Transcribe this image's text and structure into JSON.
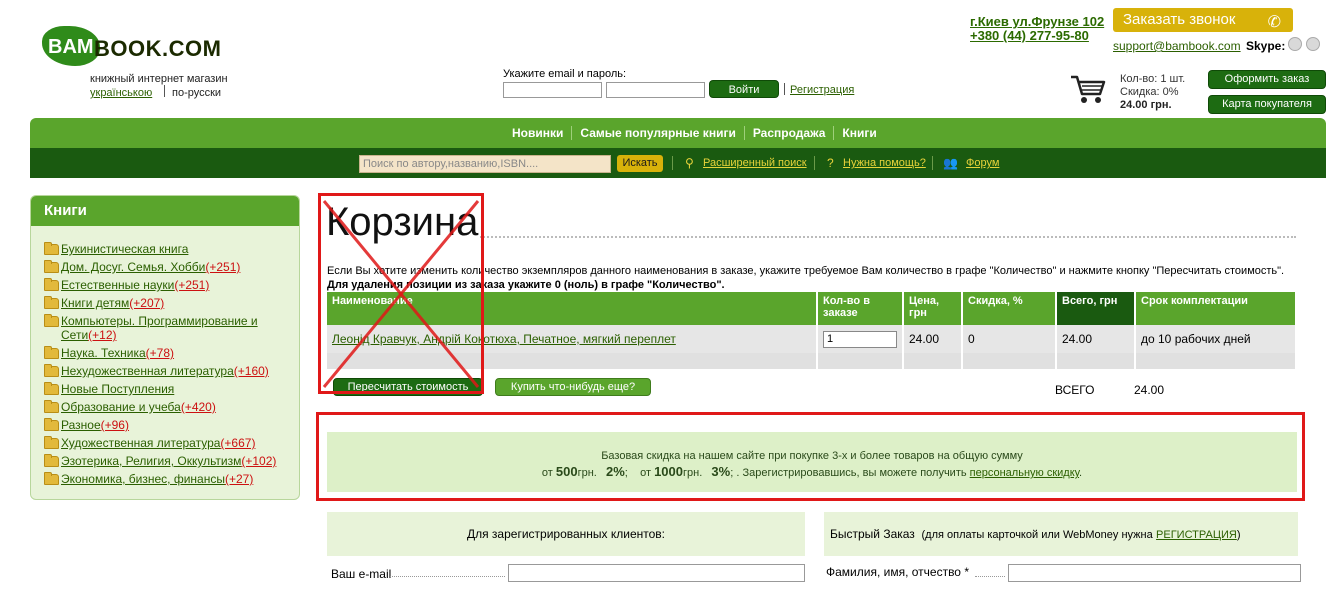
{
  "header": {
    "logo_left": "BAM",
    "logo_right": "BOOK.COM",
    "tagline": "книжный интернет магазин",
    "lang_ua": "українською",
    "lang_ru": "по-русски",
    "login_label": "Укажите email и пароль:",
    "login_button": "Войти",
    "register_link": "Регистрация",
    "address": "г.Киев ул.Фрунзе 102",
    "phone": "+380 (44) 277-95-80",
    "callback_button": "Заказать звонок",
    "support_email": "support@bambook.com",
    "skype_label": "Skype:"
  },
  "cart_widget": {
    "count": "Кол-во: 1 шт.",
    "discount": "Скидка: 0%",
    "total": "24.00 грн.",
    "order_button": "Оформить заказ",
    "card_button": "Карта покупателя"
  },
  "nav": {
    "items": [
      "Новинки",
      "Самые популярные книги",
      "Распродажа",
      "Книги"
    ],
    "search_placeholder": "Поиск по автору,названию,ISBN....",
    "search_button": "Искать",
    "advanced_search": "Расширенный поиск",
    "help": "Нужна помощь?",
    "forum": "Форум"
  },
  "sidebar": {
    "title": "Книги",
    "categories": [
      {
        "name": "Букинистическая книга",
        "count": ""
      },
      {
        "name": "Дом. Досуг. Семья. Хобби",
        "count": "(+251)"
      },
      {
        "name": "Естественные науки",
        "count": "(+251)"
      },
      {
        "name": "Книги детям",
        "count": "(+207)"
      },
      {
        "name": "Компьютеры. Программирование и Сети",
        "count": "(+12)"
      },
      {
        "name": "Наука. Техника",
        "count": "(+78)"
      },
      {
        "name": "Нехудожественная литература",
        "count": "(+160)"
      },
      {
        "name": "Новые Поступления",
        "count": ""
      },
      {
        "name": "Образование и учеба",
        "count": "(+420)"
      },
      {
        "name": "Разное",
        "count": "(+96)"
      },
      {
        "name": "Художественная литература",
        "count": "(+667)"
      },
      {
        "name": "Эзотерика, Религия, Оккультизм",
        "count": "(+102)"
      },
      {
        "name": "Экономика, бизнес, финансы",
        "count": "(+27)"
      }
    ]
  },
  "main": {
    "title": "Корзина",
    "intro": "Если Вы хотите изменить количество экземпляров данного наименования в заказе, укажите требуемое Вам количество в графе \"Количество\" и нажмите кнопку \"Пересчитать стоимость\".",
    "intro_bold": "Для удаления позиции из заказа укажите 0 (ноль) в графе \"Количество\".",
    "columns": [
      "Наименование",
      "Кол-во в заказе",
      "Цена, грн",
      "Скидка, %",
      "Всего, грн",
      "Срок комплектации"
    ],
    "row": {
      "name": "Леонід Кравчук, Андрій Кокотюха, Печатное, мягкий переплет",
      "qty": "1",
      "price": "24.00",
      "discount": "0",
      "total": "24.00",
      "term": "до 10 рабочих дней"
    },
    "recalc_button": "Пересчитать стоимость",
    "buy_more_button": "Купить что-нибудь еще?",
    "total_label": "ВСЕГО",
    "total_value": "24.00"
  },
  "discount": {
    "line1": "Базовая скидка на нашем сайте при покупке 3-х и более товаров на общую сумму",
    "from1": "от",
    "amount1": "500",
    "cur1": "грн.",
    "pct1": "2%",
    "from2": "от",
    "amount2": "1000",
    "cur2": "грн.",
    "pct2": "3%",
    "tail": ". Зарегистрировавшись, вы можете получить",
    "link": "персональную скидку"
  },
  "forms": {
    "registered_title": "Для зарегистрированных клиентов:",
    "quick_title": "Быстрый Заказ",
    "quick_note": "(для оплаты карточкой или WebMoney нужна",
    "quick_link": "РЕГИСТРАЦИЯ",
    "email_label": "Ваш e-mail",
    "fio_label": "Фамилия, имя, отчество",
    "fio_required": "*"
  },
  "colors": {
    "brand_green": "#5aa52c",
    "dark_green": "#1a5a10",
    "accent_yellow": "#d8b20a",
    "annotation_red": "#e01818"
  }
}
